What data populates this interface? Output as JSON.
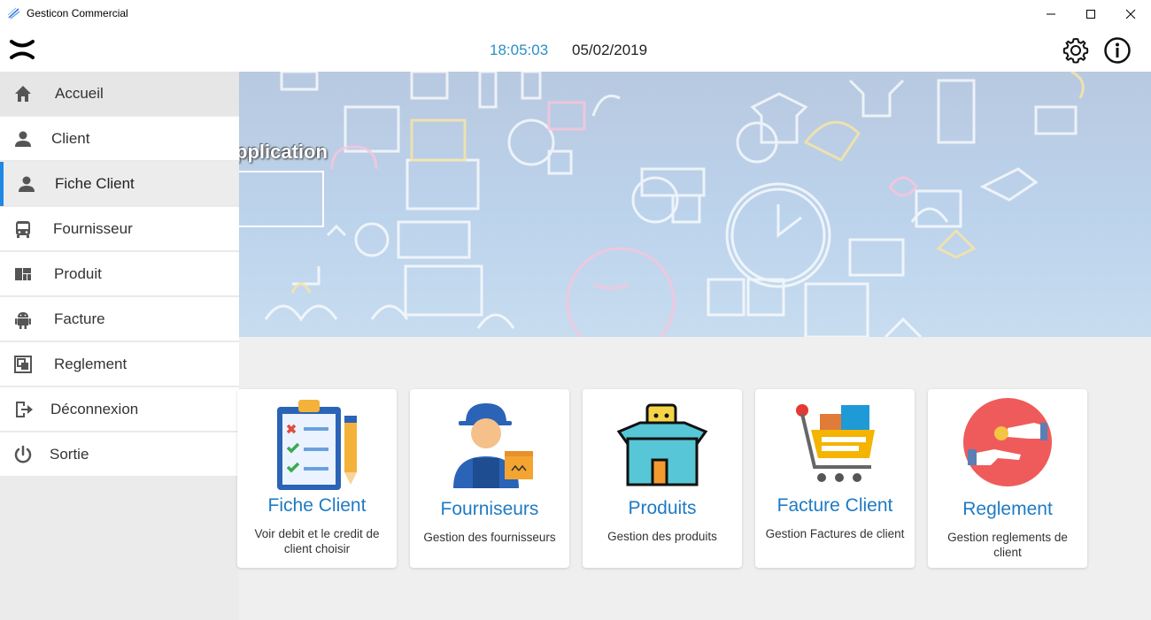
{
  "window": {
    "title": "Gesticon Commercial",
    "controls": [
      "minimize-icon",
      "maximize-icon",
      "close-icon"
    ]
  },
  "header": {
    "time": "18:05:03",
    "date": "05/02/2019",
    "icons": [
      "close-x-icon",
      "gear-icon",
      "info-icon"
    ]
  },
  "banner": {
    "text": "pplication"
  },
  "sidebar": {
    "items": [
      {
        "label": "Accueil",
        "icon": "home-icon"
      },
      {
        "label": "Client",
        "icon": "user-icon"
      },
      {
        "label": "Fiche Client",
        "icon": "user-icon"
      },
      {
        "label": "Fournisseur",
        "icon": "bus-icon"
      },
      {
        "label": "Produit",
        "icon": "dashboard-icon"
      },
      {
        "label": "Facture",
        "icon": "android-icon"
      },
      {
        "label": "Reglement",
        "icon": "frame-icon"
      },
      {
        "label": "Déconnexion",
        "icon": "logout-icon"
      },
      {
        "label": "Sortie",
        "icon": "power-icon"
      }
    ]
  },
  "cards": [
    {
      "title": "Fiche Client",
      "desc": "Voir debit et le credit de client choisir",
      "icon": "clipboard-checklist-icon"
    },
    {
      "title": "Fourniseurs",
      "desc": "Gestion des fournisseurs",
      "icon": "delivery-man-icon"
    },
    {
      "title": "Produits",
      "desc": "Gestion des produits",
      "icon": "product-box-icon"
    },
    {
      "title": "Facture Client",
      "desc": "Gestion Factures de client",
      "icon": "shopping-cart-icon"
    },
    {
      "title": "Reglement",
      "desc": "Gestion reglements de client",
      "icon": "payment-hands-icon"
    }
  ],
  "colors": {
    "accent": "#1e88e5",
    "time": "#2a8fc7",
    "card_title": "#1e7bc4"
  }
}
